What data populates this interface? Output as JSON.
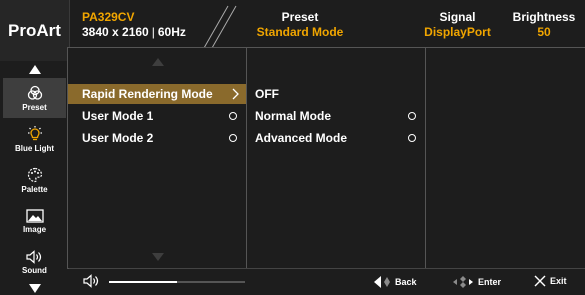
{
  "brand": "ProArt",
  "header": {
    "model": "PA329CV",
    "resolution": "3840 x 2160",
    "refresh": "60Hz",
    "preset": {
      "label": "Preset",
      "value": "Standard Mode"
    },
    "signal": {
      "label": "Signal",
      "value": "DisplayPort"
    },
    "brightness": {
      "label": "Brightness",
      "value": "50"
    }
  },
  "sidebar": {
    "items": [
      {
        "label": "Preset",
        "icon": "preset-icon",
        "active": true
      },
      {
        "label": "Blue Light",
        "icon": "blue-light-icon"
      },
      {
        "label": "Palette",
        "icon": "palette-icon"
      },
      {
        "label": "Image",
        "icon": "image-icon"
      },
      {
        "label": "Sound",
        "icon": "sound-icon"
      }
    ]
  },
  "menu1": {
    "items": [
      {
        "label": "Rapid Rendering Mode",
        "selected": true,
        "indicator": "chevron-right-icon"
      },
      {
        "label": "User Mode 1",
        "indicator": "radio"
      },
      {
        "label": "User Mode 2",
        "indicator": "radio"
      }
    ]
  },
  "menu2": {
    "items": [
      {
        "label": "OFF"
      },
      {
        "label": "Normal Mode",
        "indicator": "radio"
      },
      {
        "label": "Advanced Mode",
        "indicator": "radio"
      }
    ]
  },
  "bottombar": {
    "volume_level": 0.5,
    "back": "Back",
    "enter": "Enter",
    "exit": "Exit"
  },
  "colors": {
    "accent": "#f0a500",
    "selected_row": "#8a6a2c",
    "active_sidebar": "#3e3e3e",
    "background": "#1d1d1d"
  }
}
